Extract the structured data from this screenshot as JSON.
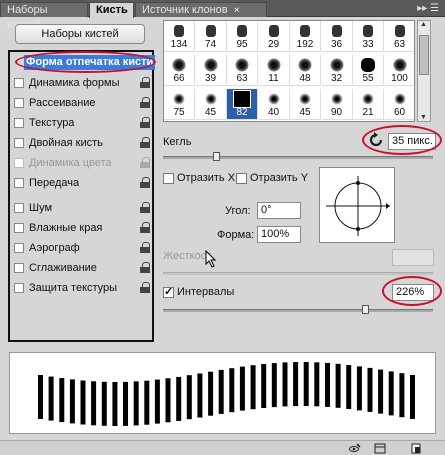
{
  "tabs": [
    {
      "label": "Наборы кистей"
    },
    {
      "label": "Кисть"
    },
    {
      "label": "Источник клонов"
    }
  ],
  "tabs_menu_glyph": "▸▸ ☰",
  "left_panel": {
    "preset_button": "Наборы кистей",
    "items": [
      {
        "label": "Форма отпечатка кисти",
        "selected": true,
        "checked": false,
        "locked": false,
        "disabled": false
      },
      {
        "label": "Динамика формы",
        "checked": false,
        "locked": true,
        "disabled": false
      },
      {
        "label": "Рассеивание",
        "checked": false,
        "locked": true,
        "disabled": false
      },
      {
        "label": "Текстура",
        "checked": false,
        "locked": true,
        "disabled": false
      },
      {
        "label": "Двойная кисть",
        "checked": false,
        "locked": true,
        "disabled": false
      },
      {
        "label": "Динамика цвета",
        "checked": false,
        "locked": true,
        "disabled": true
      },
      {
        "label": "Передача",
        "checked": false,
        "locked": true,
        "disabled": false
      },
      {
        "label": "Шум",
        "checked": false,
        "locked": true,
        "disabled": false
      },
      {
        "label": "Влажные края",
        "checked": false,
        "locked": true,
        "disabled": false
      },
      {
        "label": "Аэрограф",
        "checked": false,
        "locked": true,
        "disabled": false
      },
      {
        "label": "Сглаживание",
        "checked": false,
        "locked": true,
        "disabled": false
      },
      {
        "label": "Защита текстуры",
        "checked": false,
        "locked": true,
        "disabled": false
      }
    ]
  },
  "brush_tips": {
    "sizes": [
      "134",
      "74",
      "95",
      "29",
      "192",
      "36",
      "33",
      "63",
      "66",
      "39",
      "63",
      "11",
      "48",
      "32",
      "55",
      "100",
      "75",
      "45",
      "82",
      "40",
      "45",
      "90",
      "21",
      "60"
    ],
    "selected_index": 18
  },
  "size": {
    "label": "Кегль",
    "value": "35 пикс.",
    "fraction": 0.2
  },
  "flip_x": {
    "label": "Отразить X",
    "checked": false
  },
  "flip_y": {
    "label": "Отразить Y",
    "checked": false
  },
  "angle": {
    "label": "Угол:",
    "value": "0°"
  },
  "roundness": {
    "label": "Форма:",
    "value": "100%"
  },
  "hardness": {
    "label": "Жесткост"
  },
  "spacing": {
    "label": "Интервалы",
    "checked": true,
    "value": "226%",
    "fraction": 0.75
  },
  "colors": {
    "selection": "#3b7bdc",
    "annotation": "#c8102e",
    "tip_selected": "#2c5fa8"
  },
  "bottom_icons": [
    "eye-brush-icon",
    "panel-menu-icon",
    "new-preset-icon"
  ]
}
